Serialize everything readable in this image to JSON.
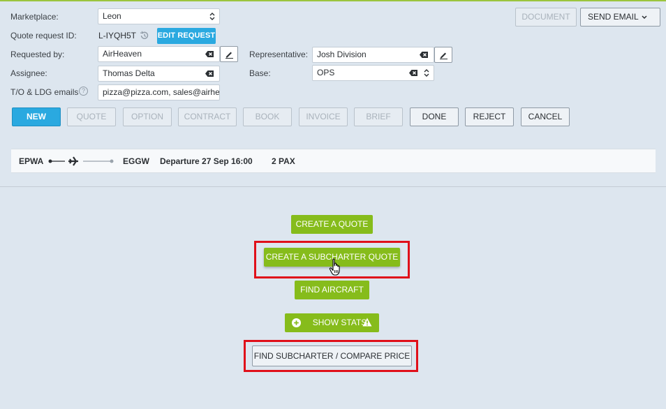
{
  "form": {
    "marketplace_label": "Marketplace:",
    "marketplace_value": "Leon",
    "quote_id_label": "Quote request ID:",
    "quote_id_value": "L-IYQH5T",
    "edit_request_label": "EDIT REQUEST",
    "requested_by_label": "Requested by:",
    "requested_by_value": "AirHeaven",
    "representative_label": "Representative:",
    "representative_value": "Josh Division",
    "assignee_label": "Assignee:",
    "assignee_value": "Thomas Delta",
    "base_label": "Base:",
    "base_value": "OPS",
    "emails_label": "T/O & LDG emails",
    "emails_value": "pizza@pizza.com, sales@airhe"
  },
  "top_actions": {
    "document_label": "DOCUMENT",
    "send_email_label": "SEND EMAIL"
  },
  "statuses": [
    "NEW",
    "QUOTE",
    "OPTION",
    "CONTRACT",
    "BOOK",
    "INVOICE",
    "BRIEF",
    "DONE",
    "REJECT",
    "CANCEL"
  ],
  "route": {
    "from": "EPWA",
    "to": "EGGW",
    "departure": "Departure 27 Sep 16:00",
    "pax": "2 PAX"
  },
  "actions": {
    "create_quote": "CREATE A QUOTE",
    "create_subcharter_quote": "CREATE A SUBCHARTER QUOTE",
    "find_aircraft": "FIND AIRCRAFT",
    "show_stats": "SHOW STATS",
    "find_subcharter": "FIND SUBCHARTER / COMPARE PRICE"
  },
  "colors": {
    "accent_green": "#86bc1b",
    "accent_blue": "#2aa9e0",
    "highlight_red": "#e0101a",
    "background": "#dde6ef"
  }
}
